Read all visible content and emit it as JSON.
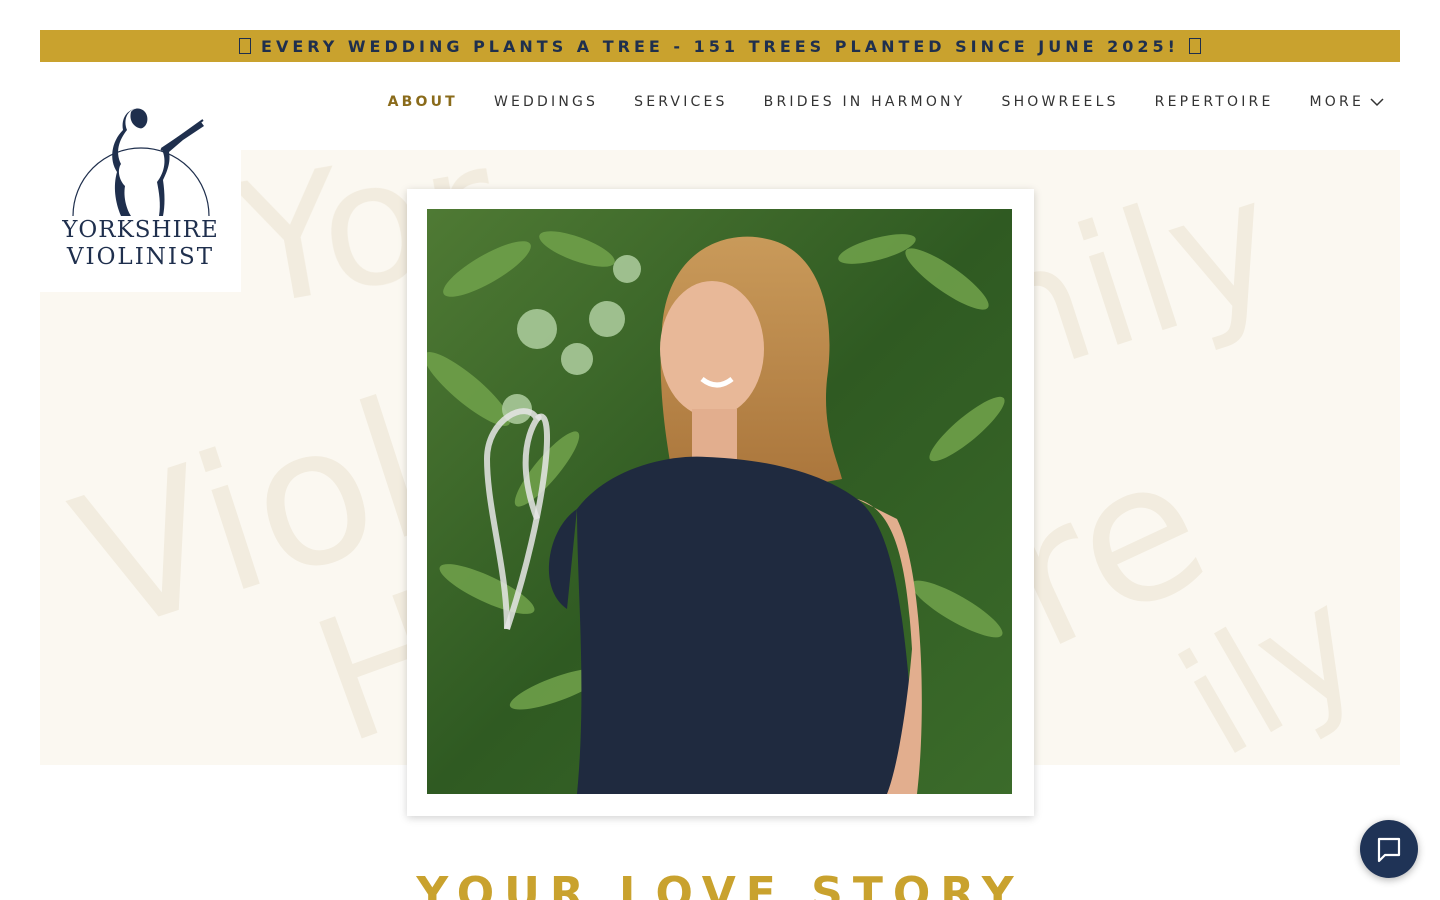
{
  "banner": {
    "text": "EVERY WEDDING PLANTS A TREE - 151 TREES PLANTED SINCE JUNE 2025!",
    "left_icon": "unknown-glyph-icon",
    "right_icon": "unknown-glyph-icon"
  },
  "logo": {
    "line1": "YORKSHIRE",
    "line2": "VIOLINIST",
    "icon": "violinist-silhouette-icon"
  },
  "nav": {
    "items": [
      {
        "label": "ABOUT",
        "active": true
      },
      {
        "label": "WEDDINGS",
        "active": false
      },
      {
        "label": "SERVICES",
        "active": false
      },
      {
        "label": "BRIDES IN HARMONY",
        "active": false
      },
      {
        "label": "SHOWREELS",
        "active": false
      },
      {
        "label": "REPERTOIRE",
        "active": false
      },
      {
        "label": "MORE",
        "active": false
      }
    ]
  },
  "hero": {
    "headline": "YOUR LOVE STORY"
  },
  "colors": {
    "accent_gold": "#c9a22e",
    "navy": "#1f2f4d",
    "active_nav": "#8a6b1b",
    "hero_bg": "#fbf8f1"
  },
  "chat": {
    "icon": "chat-bubble-icon"
  }
}
